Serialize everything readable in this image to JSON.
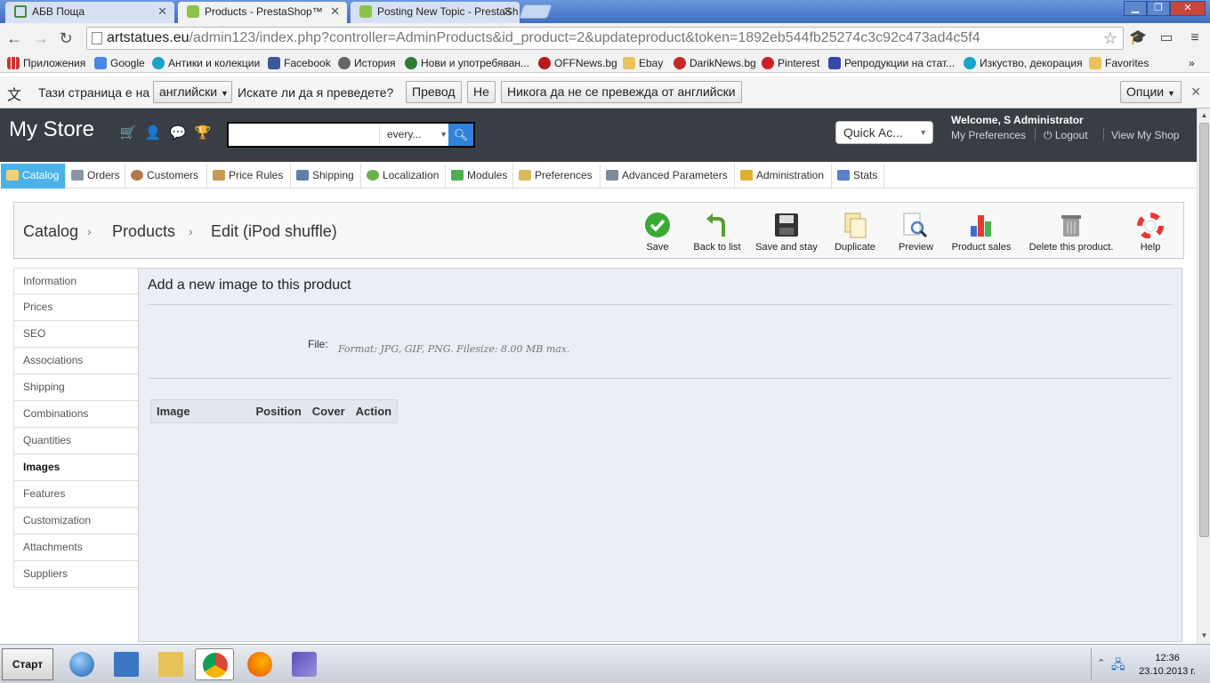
{
  "browser": {
    "tabs": [
      {
        "label": "АБВ Поща",
        "active": false
      },
      {
        "label": "Products - PrestaShop™",
        "active": true
      },
      {
        "label": "Posting New Topic - PrestaSh",
        "active": false
      }
    ],
    "url_host": "artstatues.eu",
    "url_path": "/admin123/index.php?controller=AdminProducts&id_product=2&updateproduct&token=1892eb544fb25274c3c92c473ad4c5f4",
    "bookmarks": [
      "Приложения",
      "Google",
      "Антики и колекции",
      "Facebook",
      "История",
      "Нови и употребяван...",
      "OFFNews.bg",
      "Ebay",
      "DarikNews.bg",
      "Pinterest",
      "Репродукции на стат...",
      "Изкуство, декорация",
      "Favorites"
    ]
  },
  "translate_bar": {
    "text1": "Тази страница е на",
    "language": "английски",
    "text2": "Искате ли да я преведете?",
    "translate": "Превод",
    "no": "Не",
    "never": "Никога да не се превежда от английски",
    "options": "Опции"
  },
  "header": {
    "shop_name": "My Store",
    "search_placeholder": "",
    "search_type": "every...",
    "quick_access": "Quick Ac...",
    "welcome_prefix": "Welcome, ",
    "welcome_name": "S Administrator",
    "my_preferences": "My Preferences",
    "logout": "Logout",
    "view_shop": "View My Shop"
  },
  "menu": [
    "Catalog",
    "Orders",
    "Customers",
    "Price Rules",
    "Shipping",
    "Localization",
    "Modules",
    "Preferences",
    "Advanced Parameters",
    "Administration",
    "Stats"
  ],
  "breadcrumb": [
    "Catalog",
    "Products",
    "Edit (iPod shuffle)"
  ],
  "tools": [
    "Save",
    "Back to list",
    "Save and stay",
    "Duplicate",
    "Preview",
    "Product sales",
    "Delete this product.",
    "Help"
  ],
  "side_tabs": [
    "Information",
    "Prices",
    "SEO",
    "Associations",
    "Shipping",
    "Combinations",
    "Quantities",
    "Images",
    "Features",
    "Customization",
    "Attachments",
    "Suppliers"
  ],
  "content": {
    "title": "Add a new image to this product",
    "file_label": "File:",
    "file_hint": "Format: JPG, GIF, PNG. Filesize: 8.00 MB max.",
    "table_headers": [
      "Image",
      "Position",
      "Cover",
      "Action"
    ]
  },
  "taskbar": {
    "start": "Старт",
    "time": "12:36",
    "date": "23.10.2013 г."
  },
  "colors": {
    "header_bg": "#383e44",
    "menu_active": "#49b2e9",
    "search_btn": "#2f82d8",
    "content_bg": "#ebeef5"
  }
}
